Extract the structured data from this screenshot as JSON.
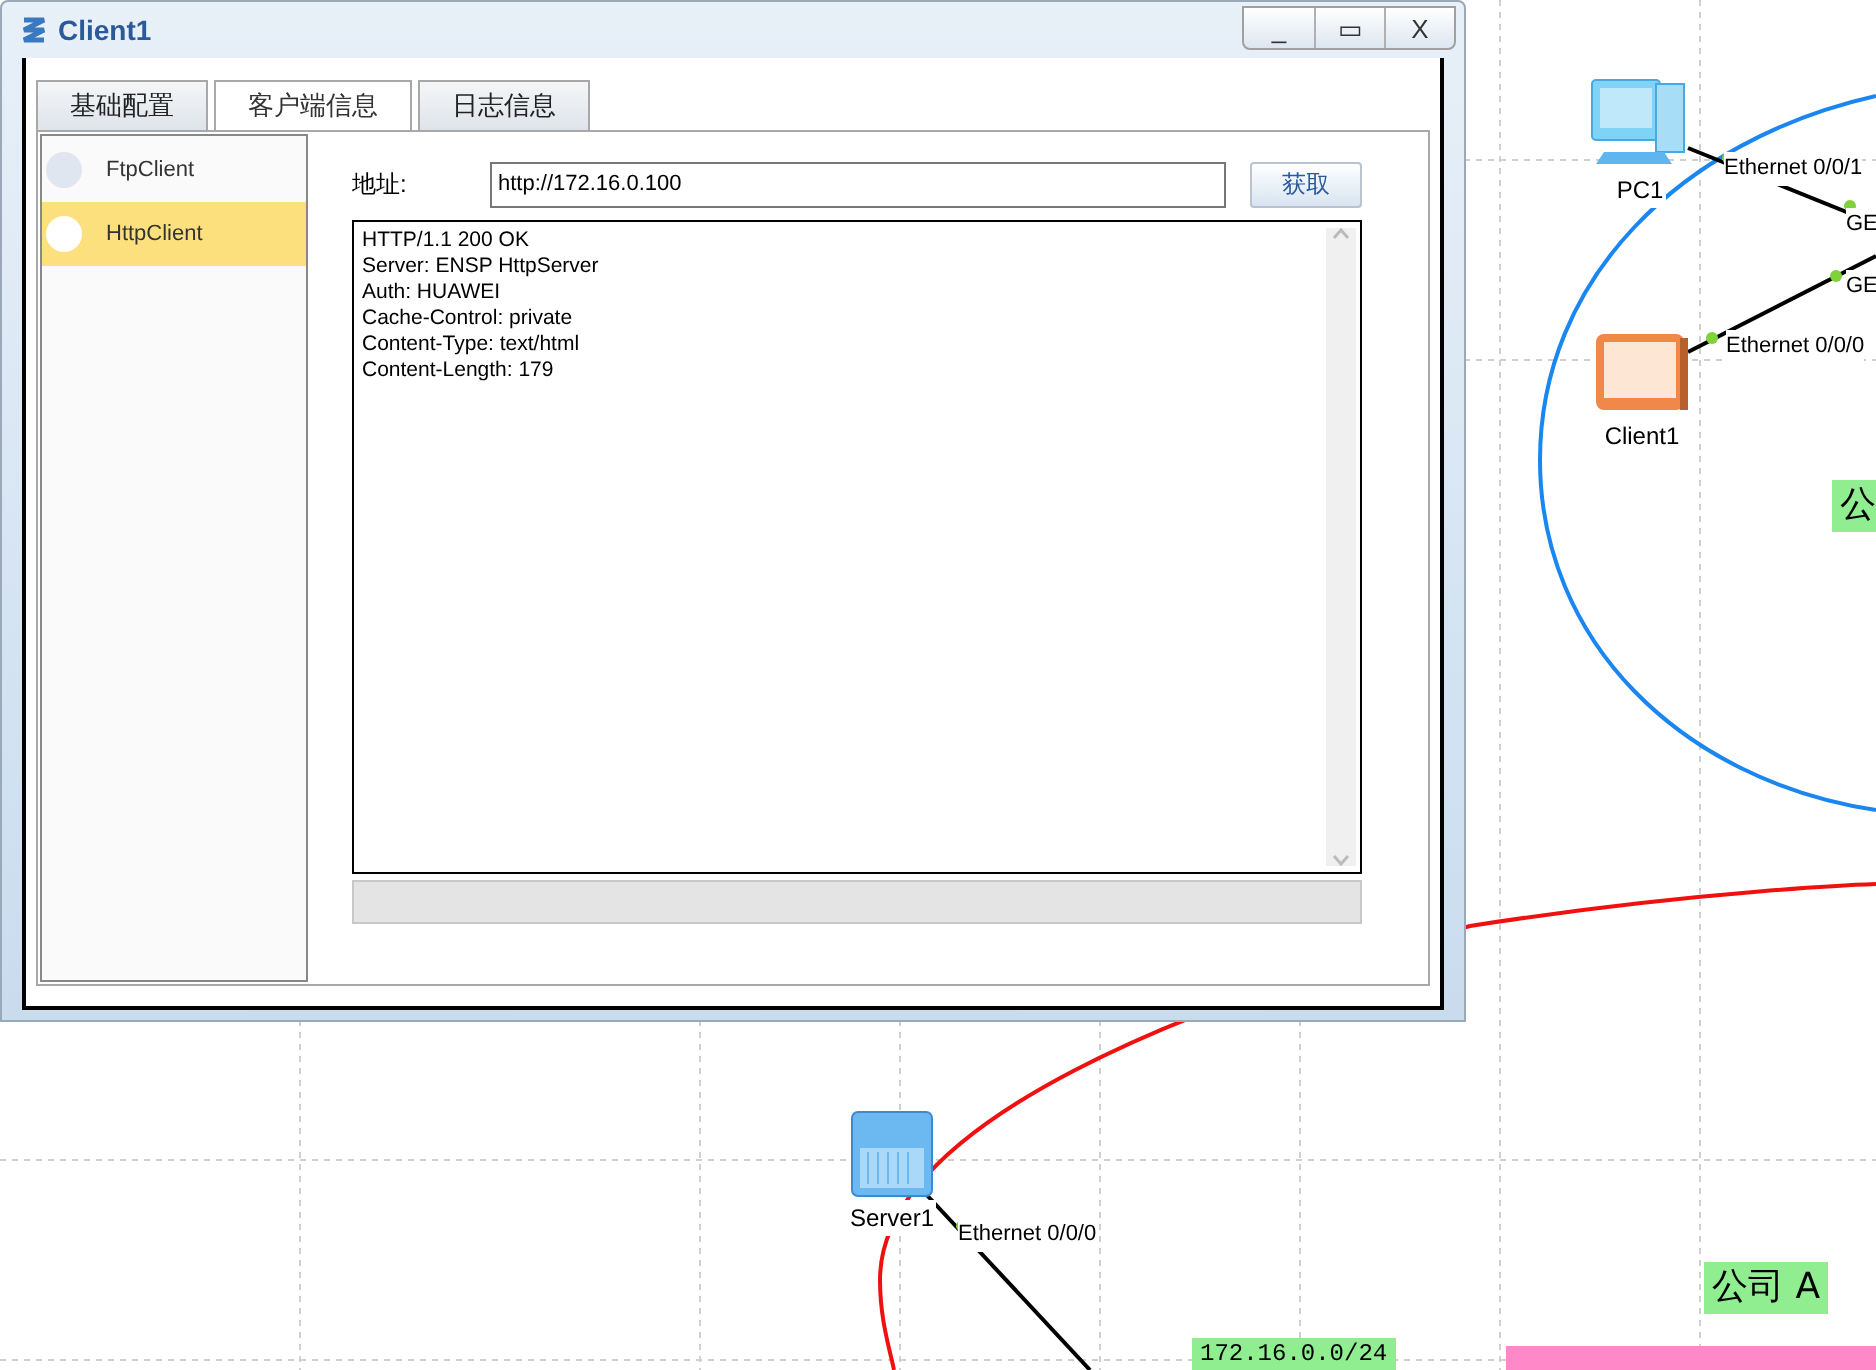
{
  "window": {
    "title": "Client1",
    "controls": [
      "_",
      "▭",
      "X"
    ]
  },
  "tabs": [
    {
      "label": "基础配置",
      "selected": false
    },
    {
      "label": "客户端信息",
      "selected": true
    },
    {
      "label": "日志信息",
      "selected": false
    }
  ],
  "client_list": [
    {
      "label": "FtpClient",
      "selected": false
    },
    {
      "label": "HttpClient",
      "selected": true
    }
  ],
  "address": {
    "label": "地址:",
    "value": "http://172.16.0.100"
  },
  "fetch_button": "获取",
  "response": [
    "HTTP/1.1 200 OK",
    "Server: ENSP HttpServer",
    "Auth: HUAWEI",
    "Cache-Control: private",
    "Content-Type: text/html",
    "Content-Length: 179"
  ],
  "canvas": {
    "devices": [
      {
        "kind": "pc",
        "name": "PC1"
      },
      {
        "kind": "http-client",
        "name": "Client1"
      },
      {
        "kind": "server",
        "name": "Server1"
      }
    ],
    "port_labels": [
      "Ethernet 0/0/1",
      "GE",
      "GE",
      "Ethernet 0/0/0",
      "Ethernet 0/0/0"
    ],
    "area_labels": [
      "公",
      "公司 A"
    ],
    "network_label": "172.16.0.0/24"
  }
}
